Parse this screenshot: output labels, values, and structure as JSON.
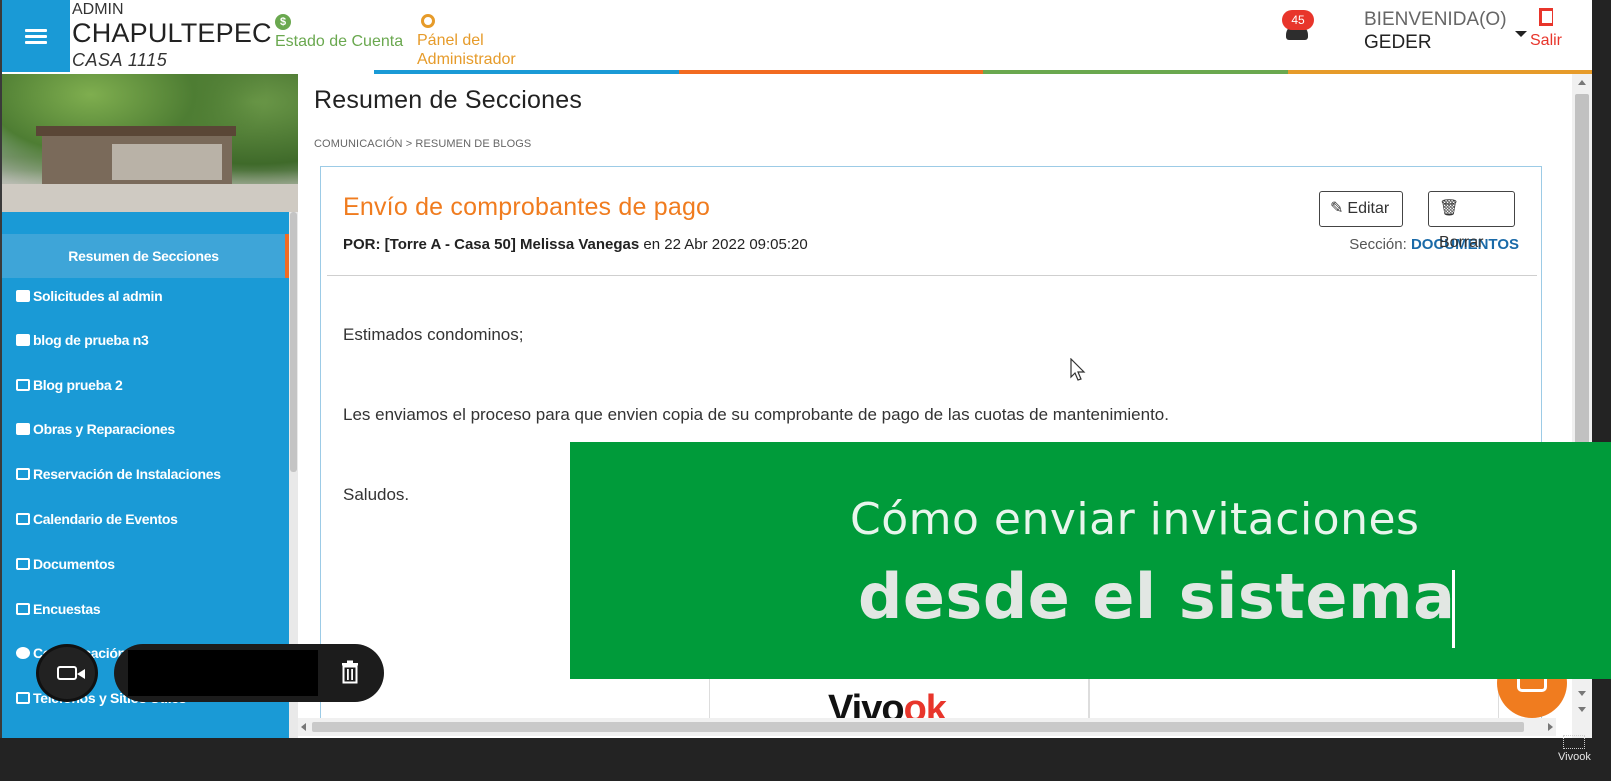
{
  "header": {
    "role_label": "ADMIN",
    "brand_name": "CHAPULTEPEC",
    "unit_label": "CASA 1115",
    "links": {
      "estado_cuenta": "Estado de Cuenta",
      "panel_line1": "Pánel del",
      "panel_line2": "Administrador"
    },
    "notifications_count": "45",
    "welcome_line1": "BIENVENIDA(O)",
    "welcome_line2": "GEDER",
    "logout_label": "Salir",
    "colorbar": [
      "#ffffff",
      "#1a9ad6",
      "#f26b21",
      "#6aa84f",
      "#e69b2a"
    ]
  },
  "sidebar": {
    "active_item": "Resumen de Secciones",
    "items": [
      {
        "label": "Solicitudes al admin",
        "icon": "layers-icon"
      },
      {
        "label": "blog de prueba n3",
        "icon": "binoculars-icon"
      },
      {
        "label": "Blog prueba 2",
        "icon": "square-icon"
      },
      {
        "label": "Obras y Reparaciones",
        "icon": "hammer-icon"
      },
      {
        "label": "Reservación de Instalaciones",
        "icon": "calendar-grid-icon"
      },
      {
        "label": "Calendario de Eventos",
        "icon": "calendar-icon"
      },
      {
        "label": "Documentos",
        "icon": "document-icon"
      },
      {
        "label": "Encuestas",
        "icon": "checkbox-icon"
      },
      {
        "label": "Comunicación",
        "icon": "chat-icon"
      },
      {
        "label": "Telefonos y Sitios Utiles",
        "icon": "square-icon"
      }
    ]
  },
  "main": {
    "page_title": "Resumen de Secciones",
    "breadcrumb": "COMUNICACIÓN > RESUMEN DE BLOGS",
    "post": {
      "title": "Envío de comprobantes de pago",
      "author_prefix": "POR:",
      "author": "[Torre A - Casa 50] Melissa Vanegas",
      "date_text": "en 22 Abr 2022 09:05:20",
      "section_label": "Sección:",
      "section_value": "DOCUMENTOS",
      "edit_label": "Editar",
      "delete_label": "Borrar",
      "body": [
        "Estimados condominos;",
        "Les enviamos el proceso para que envien copia de su comprobante de pago de las cuotas de mantenimiento.",
        "Saludos."
      ]
    },
    "logo_text_a": "Vivo",
    "logo_text_b": "ok"
  },
  "overlay": {
    "line1": "Cómo enviar invitaciones",
    "line2": "desde el sistema",
    "bg_color": "#009b3a"
  },
  "watermark": "Vivook"
}
